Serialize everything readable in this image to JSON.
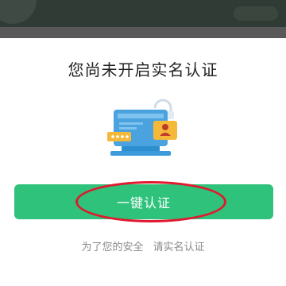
{
  "dialog": {
    "title": "您尚未开启实名认证",
    "button_label": "一键认证",
    "hint_left": "为了您的安全",
    "hint_right": "请实名认证"
  },
  "colors": {
    "button": "#2ec27b",
    "annotation_circle": "#e0192e",
    "illustration_blue": "#4aa3df",
    "illustration_yellow": "#f5b93a"
  },
  "icons": {
    "illustration": "id-verification-illustration",
    "user_badge": "user-icon",
    "password_dots": "password-dots-icon",
    "lock": "lock-icon"
  }
}
